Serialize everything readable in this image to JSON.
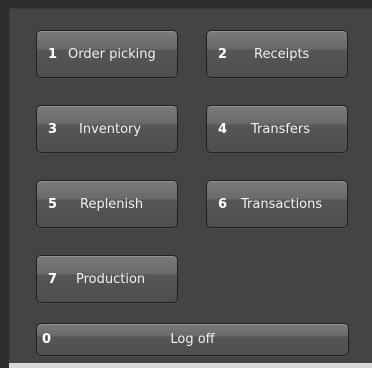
{
  "menu": {
    "buttons": [
      {
        "number": "1",
        "label": "Order picking"
      },
      {
        "number": "2",
        "label": "Receipts"
      },
      {
        "number": "3",
        "label": "Inventory"
      },
      {
        "number": "4",
        "label": "Transfers"
      },
      {
        "number": "5",
        "label": "Replenish"
      },
      {
        "number": "6",
        "label": "Transactions"
      },
      {
        "number": "7",
        "label": "Production"
      }
    ],
    "logoff": {
      "number": "0",
      "label": "Log off"
    }
  },
  "colors": {
    "background": "#444444",
    "button_top": "#7a7a7a",
    "button_bottom": "#4e4e4e",
    "button_text": "#f2f2f2"
  }
}
